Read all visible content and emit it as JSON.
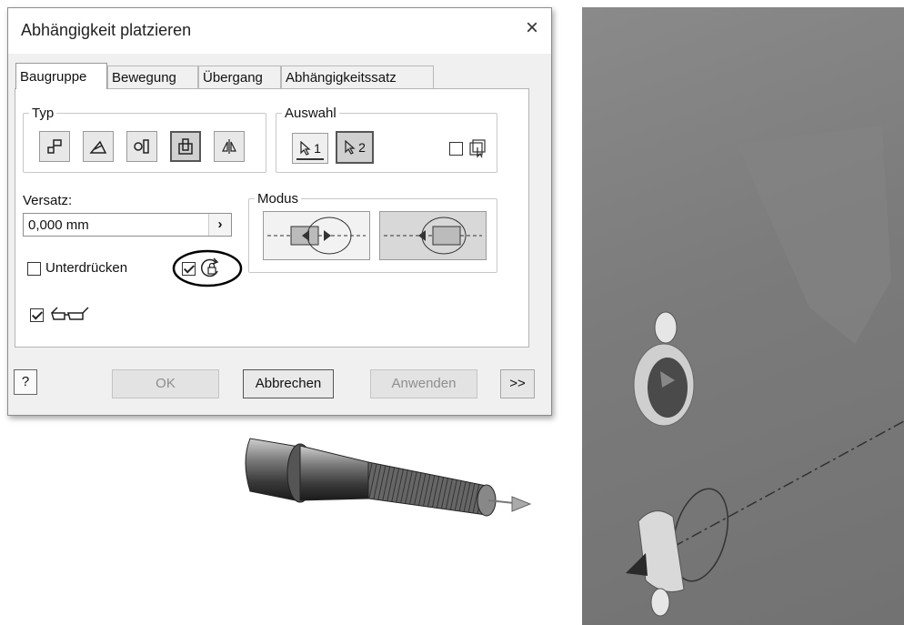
{
  "dialog": {
    "title": "Abhängigkeit platzieren",
    "close_label": "×",
    "tabs": [
      {
        "label": "Baugruppe",
        "active": true
      },
      {
        "label": "Bewegung",
        "active": false
      },
      {
        "label": "Übergang",
        "active": false
      },
      {
        "label": "Abhängigkeitssatz",
        "active": false
      }
    ],
    "typ": {
      "legend": "Typ",
      "buttons": [
        {
          "icon": "mate-constraint-icon"
        },
        {
          "icon": "angle-constraint-icon"
        },
        {
          "icon": "tangent-constraint-icon"
        },
        {
          "icon": "insert-constraint-icon",
          "selected": true
        },
        {
          "icon": "symmetry-constraint-icon"
        }
      ]
    },
    "auswahl": {
      "legend": "Auswahl",
      "select1_label": "1",
      "select2_label": "2",
      "first_occurrence_checked": false
    },
    "versatz": {
      "label": "Versatz:",
      "value": "0,000 mm",
      "arrow": "›"
    },
    "modus": {
      "legend": "Modus",
      "options": [
        {
          "icon": "insert-opposed-icon",
          "selected": false
        },
        {
          "icon": "insert-aligned-icon",
          "selected": true
        }
      ]
    },
    "unterdruecken": {
      "label": "Unterdrücken",
      "checked": false
    },
    "lock_rotation": {
      "checked": true,
      "icon": "lock-rotation-icon"
    },
    "preview": {
      "checked": true,
      "icon": "glasses-icon"
    },
    "footer": {
      "help_label": "?",
      "ok": "OK",
      "abbrechen": "Abbrechen",
      "anwenden": "Anwenden",
      "more": ">>"
    }
  },
  "colors": {
    "dialog_bg": "#f0f0f0",
    "annotation_circle": "#000000",
    "viewport_bg": "#7b7b7b"
  }
}
